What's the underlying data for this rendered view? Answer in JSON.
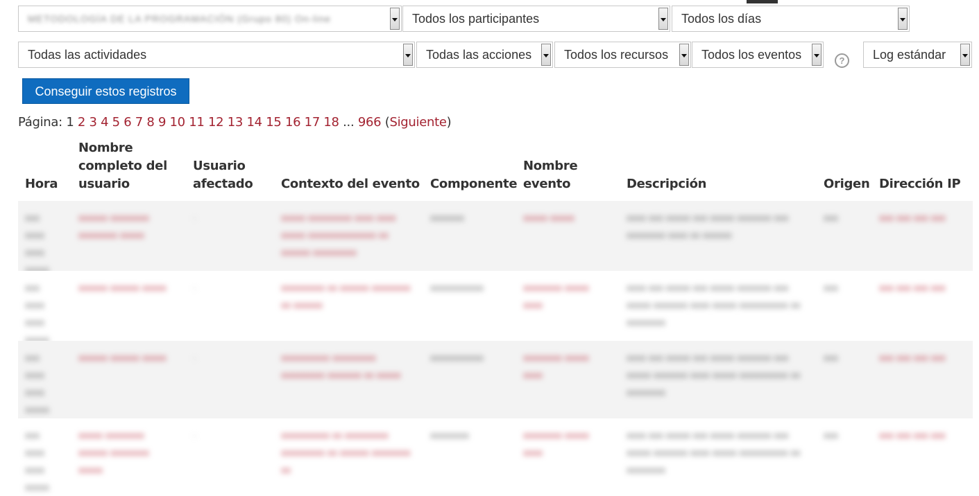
{
  "filters": {
    "course": "METODOLOGÍA DE LA PROGRAMACIÓN (Grupo 80) On-line",
    "participants": "Todos los participantes",
    "days": "Todos los días",
    "activities": "Todas las actividades",
    "actions": "Todas las acciones",
    "resources": "Todos los recursos",
    "events": "Todos los eventos",
    "help": "?",
    "log_type": "Log estándar"
  },
  "submit_button": "Conseguir estos registros",
  "pagination": {
    "label": "Página:",
    "current": "1",
    "pages": [
      "2",
      "3",
      "4",
      "5",
      "6",
      "7",
      "8",
      "9",
      "10",
      "11",
      "12",
      "13",
      "14",
      "15",
      "16",
      "17",
      "18"
    ],
    "ellipsis": "...",
    "last": "966",
    "next": "Siguiente"
  },
  "table": {
    "headers": {
      "time": "Hora",
      "fullname": "Nombre completo del usuario",
      "affected": "Usuario afectado",
      "context": "Contexto del evento",
      "component": "Componente",
      "event_name": "Nombre evento",
      "description": "Descripción",
      "origin": "Origen",
      "ip": "Dirección IP"
    },
    "rows": [
      {
        "time": "xxx xxxx xxxx xxxxx",
        "user": "xxxxxx xxxxxxxx xxxxxxxx xxxxx",
        "affected": "-",
        "context": "xxxxx xxxxxxxxx xxxx xxxx xxxxx xxxxxxxxxxxxxx xx xxxxxx xxxxxxxxx",
        "component": "xxxxxxx",
        "event": "xxxxx xxxxx",
        "description": "xxxx xxx xxxxx xxx xxxxx xxxxxxx xxx xxxxxxxx xxxx xx xxxxxx",
        "origin": "xxx",
        "ip": "xxx xxx xxx xxx"
      },
      {
        "time": "xxx xxxx xxxx xxxxx",
        "user": "xxxxxx xxxxxx xxxxx",
        "affected": "-",
        "context": "xxxxxxxxx xx xxxxxx xxxxxxxx xx xxxxxx",
        "component": "xxxxxxxxxxx",
        "event": "xxxxxxxx xxxxx xxxx",
        "description": "xxxx xxx xxxxx xxx xxxxx xxxxxxx xxx xxxxx xxxxxxx xxxx xxxxx xxxxxxxxxx xx xxxxxxxx",
        "origin": "xxx",
        "ip": "xxx xxx xxx xxx"
      },
      {
        "time": "xxx xxxx xxxx xxxxx",
        "user": "xxxxxx xxxxxx xxxxx",
        "affected": "-",
        "context": "xxxxxxxxxx xxxxxxxxx xxxxxxxxx xxxxxxx xx xxxxx",
        "component": "xxxxxxxxxxx",
        "event": "xxxxxxxx xxxxx xxxx",
        "description": "xxxx xxx xxxxx xxx xxxxx xxxxxxx xxx xxxxx xxxxxxx xxxx xxxxx xxxxxxxxxx xx xxxxxxxx",
        "origin": "xxx",
        "ip": "xxx xxx xxx xxx"
      },
      {
        "time": "xxx xxxx xxxx xxxxx",
        "user": "xxxxx xxxxxxxx xxxxxx xxxxxxxx xxxxx",
        "affected": "-",
        "context": "xxxxxxxxxx xx xxxxxxxxx xxxxxxxxx xx xxxxxx xxxxxxxx xx",
        "component": "xxxxxxxx",
        "event": "xxxxxxxx xxxxx xxxx",
        "description": "xxxx xxx xxxxx xxx xxxxx xxxxxxx xxx xxxxx xxxxxxx xxxx xxxxx xxxxxxxxxx xx xxxxxxxx",
        "origin": "xxx",
        "ip": "xxx xxx xxx xxx"
      }
    ]
  }
}
